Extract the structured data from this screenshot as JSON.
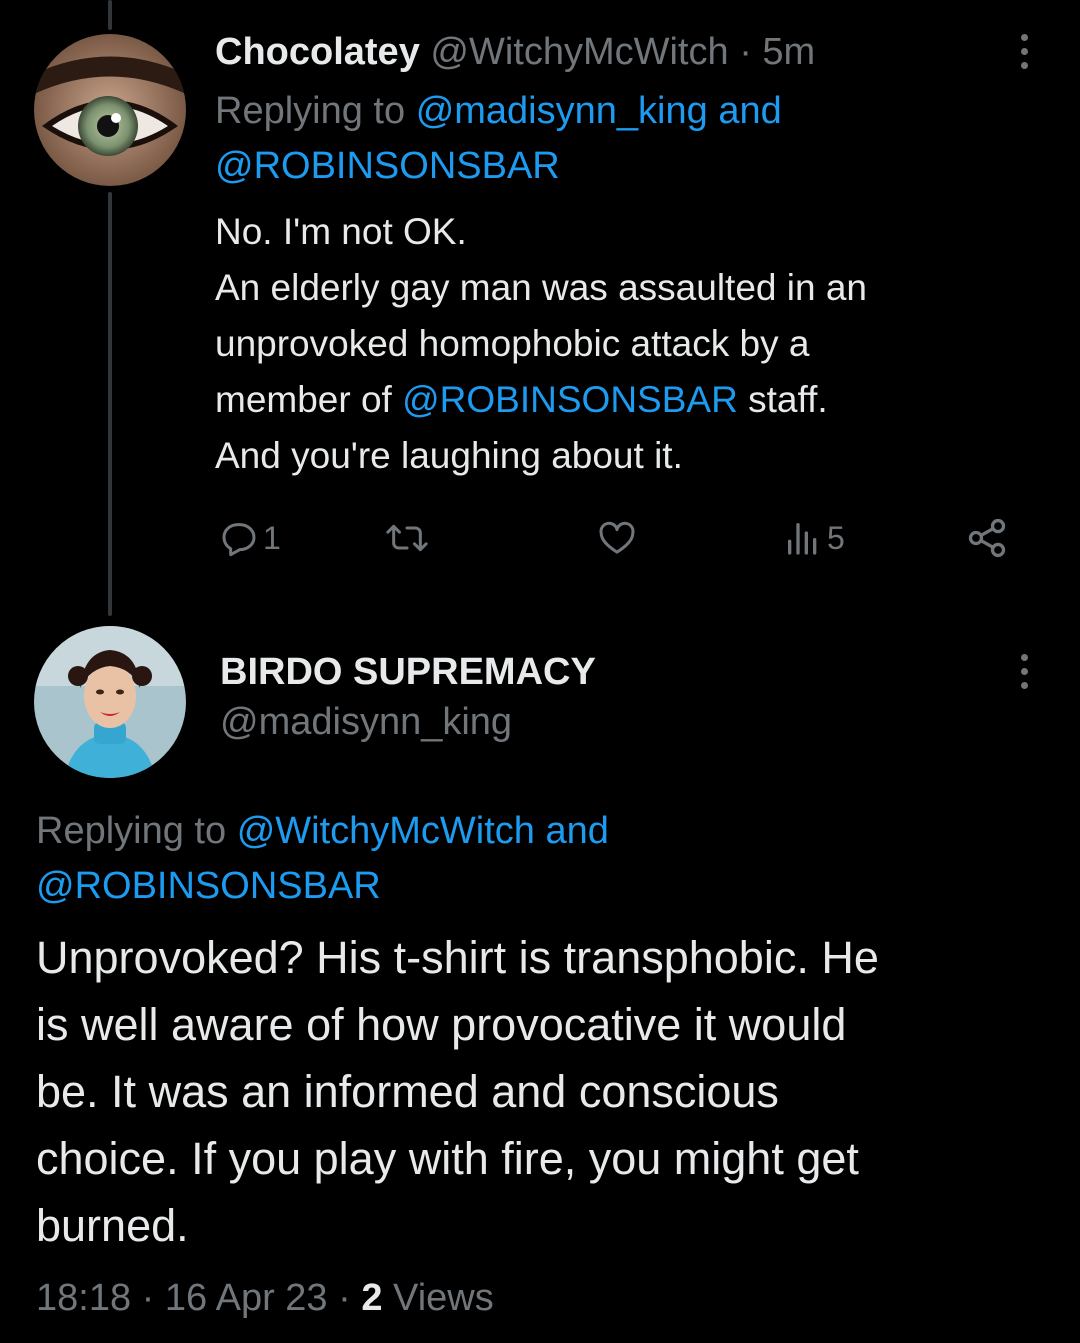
{
  "colors": {
    "background": "#000000",
    "text": "#e7e9ea",
    "muted": "#71767b",
    "link": "#1d9bf0"
  },
  "tweet1": {
    "display_name": "Chocolatey",
    "handle": "@WitchyMcWitch",
    "separator": "·",
    "time": "5m",
    "replying_prefix": "Replying to",
    "replying_user1": "@madisynn_king",
    "replying_and": "and",
    "replying_user2": "@ROBINSONSBAR",
    "body": {
      "line1": "No. I'm not OK.",
      "line2": "An elderly gay man was assaulted in an",
      "line3": "unprovoked homophobic attack by a",
      "line4_pre": "member of",
      "line4_mention": "@ROBINSONSBAR",
      "line4_post": "staff.",
      "line5": "And you're laughing about it."
    },
    "actions": {
      "reply_count": "1",
      "retweet_count": "",
      "like_count": "",
      "views_count": "5"
    },
    "avatar_icon": "eye-avatar",
    "more_icon": "more-dots-icon"
  },
  "tweet2": {
    "display_name": "BIRDO SUPREMACY",
    "handle": "@madisynn_king",
    "replying_prefix": "Replying to",
    "replying_user1": "@WitchyMcWitch",
    "replying_and": "and",
    "replying_user2": "@ROBINSONSBAR",
    "body": {
      "line1": "Unprovoked? His t-shirt is transphobic. He",
      "line2": "is well aware of how provocative it would",
      "line3": "be. It was an informed and conscious",
      "line4": "choice. If you play with fire, you might get",
      "line5": "burned."
    },
    "meta": {
      "time": "18:18",
      "sep1": "·",
      "date": "16 Apr 23",
      "sep2": "·",
      "views_count": "2",
      "views_label": "Views"
    },
    "avatar_icon": "portrait-avatar",
    "more_icon": "more-dots-icon"
  }
}
